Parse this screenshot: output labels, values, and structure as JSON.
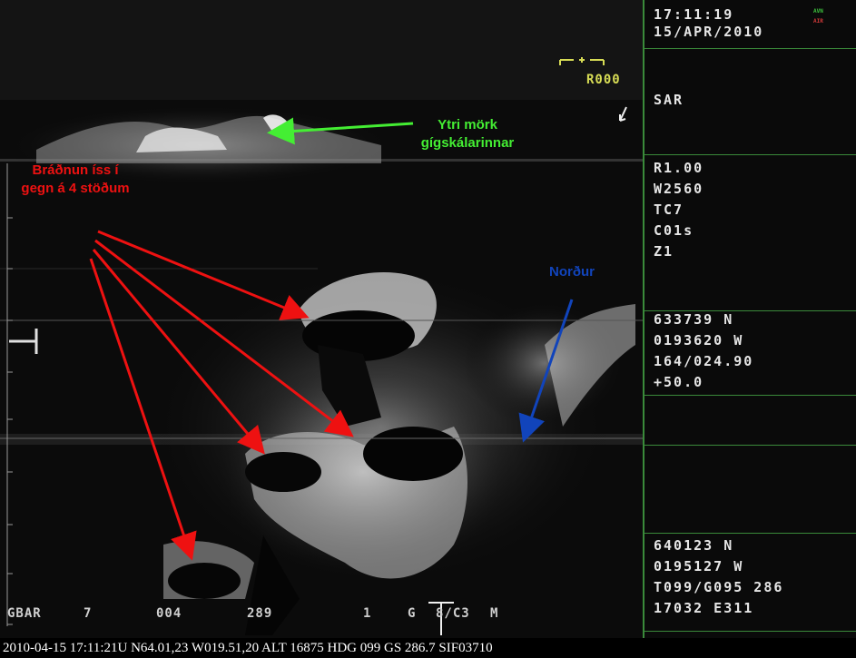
{
  "header": {
    "time": "17:11:19",
    "date": "15/APR/2010",
    "indicator_top": "AVN",
    "indicator_bottom": "AIR"
  },
  "mode": "SAR",
  "settings": [
    "R1.00",
    "W2560",
    "TC7",
    "C01s",
    "Z1"
  ],
  "target": [
    "633739 N",
    "0193620 W",
    "164/024.90",
    "+50.0"
  ],
  "aircraft": [
    "640123 N",
    "0195127 W",
    "T099/G095 286",
    "17032 E311"
  ],
  "reticle_label": "R000",
  "annotations": {
    "rim": "Ytri mörk gígskálarinnar",
    "melt": "Bráðnun íss í gegn á 4 stöðum",
    "north": "Norður"
  },
  "bottom_row": [
    "GBAR",
    "7",
    "004",
    "289",
    "1",
    "G",
    "8/C3",
    "M"
  ],
  "caption": "2010-04-15 17:11:21U N64.01,23 W019.51,20 ALT 16875 HDG 099 GS 286.7 SIF03710",
  "colors": {
    "panel_line": "#3a8a3a",
    "rim_annotation": "#44ee33",
    "melt_annotation": "#ee1111",
    "north_annotation": "#1144bb",
    "reticle": "#d7dc55"
  }
}
